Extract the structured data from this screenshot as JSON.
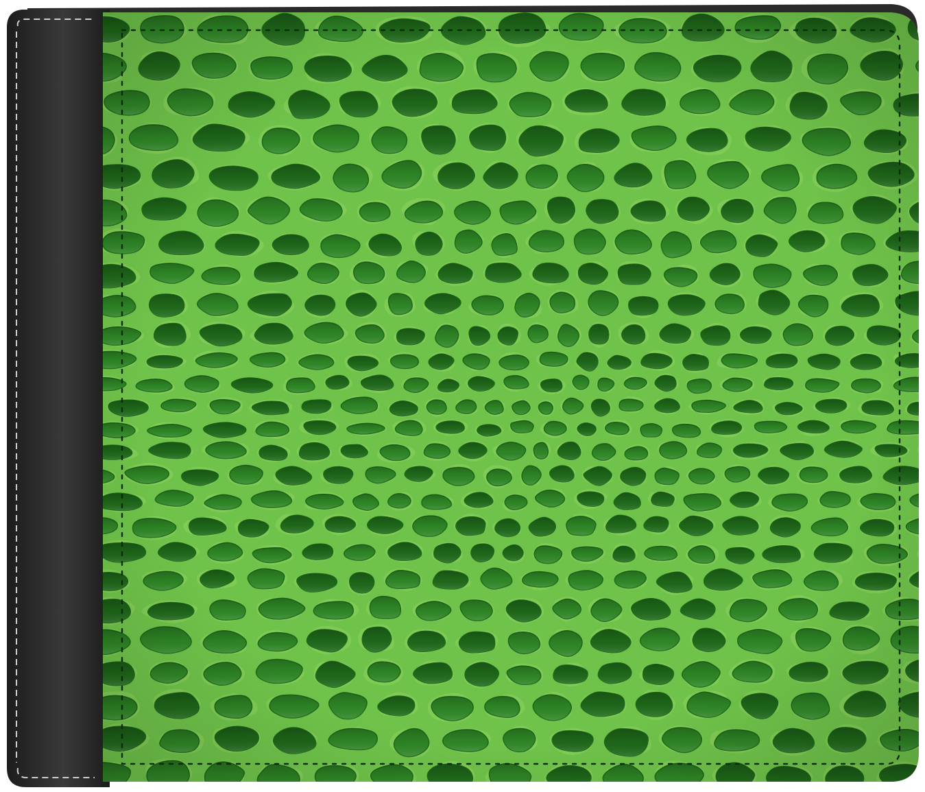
{
  "product": {
    "object": "bifold-wallet",
    "view": "front",
    "cover_pattern": "crocodile-skin",
    "colors": {
      "background": "#ffffff",
      "spine": "#1c1c1c",
      "spine_highlight": "#3a3a3a",
      "spine_stitch": "#cfcfcf",
      "scale_base": "#6fc24a",
      "scale_light": "#8ed35e",
      "scale_fill": "#2f8a26",
      "scale_dark": "#1f6b1a",
      "border_stitch": "#0a2a0a"
    }
  }
}
